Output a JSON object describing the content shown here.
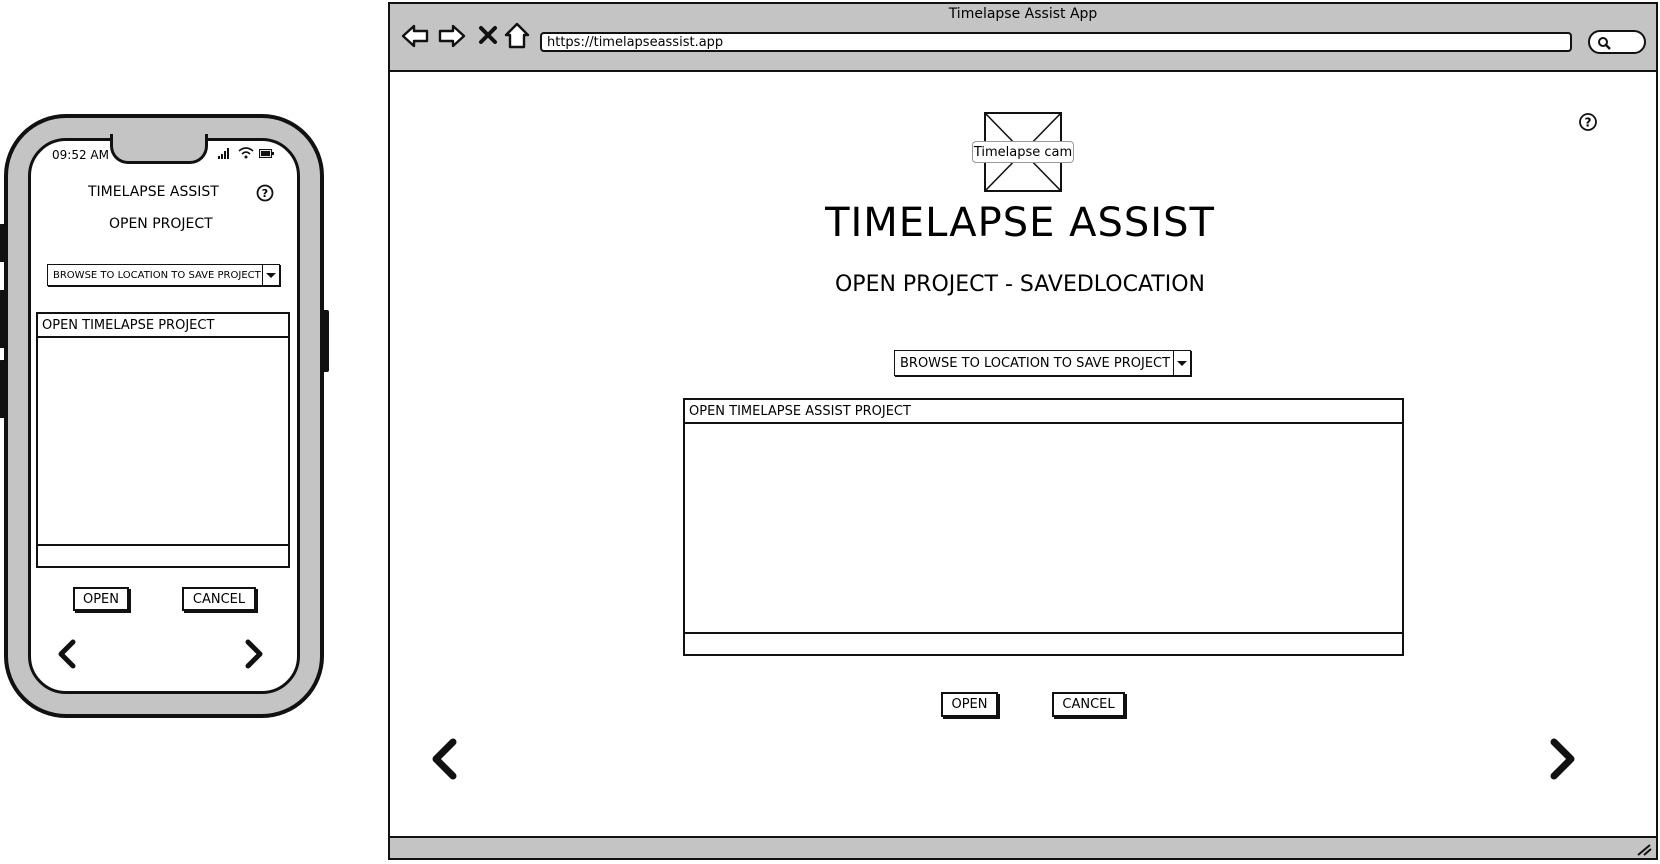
{
  "phone": {
    "status_time": "09:52 AM",
    "app_title": "TIMELAPSE ASSIST",
    "screen_title": "OPEN PROJECT",
    "browse_dropdown": "BROWSE TO LOCATION TO SAVE PROJECT",
    "panel_header": "OPEN TIMELAPSE PROJECT",
    "open_button": "OPEN",
    "cancel_button": "CANCEL",
    "help_icon": "help-circle-icon",
    "back_icon": "chevron-left-icon",
    "forward_icon": "chevron-right-icon"
  },
  "browser": {
    "window_title": "Timelapse Assist App",
    "url": "https://timelapseassist.app",
    "nav_icons": [
      "back-arrow-icon",
      "forward-arrow-icon",
      "close-x-icon",
      "home-icon",
      "search-icon"
    ],
    "logo_caption": "Timelapse cam",
    "app_title": "TIMELAPSE ASSIST",
    "screen_title": "OPEN PROJECT - SAVEDLOCATION",
    "browse_dropdown": "BROWSE TO LOCATION TO SAVE PROJECT",
    "panel_header": "OPEN TIMELAPSE ASSIST PROJECT",
    "open_button": "OPEN",
    "cancel_button": "CANCEL"
  }
}
